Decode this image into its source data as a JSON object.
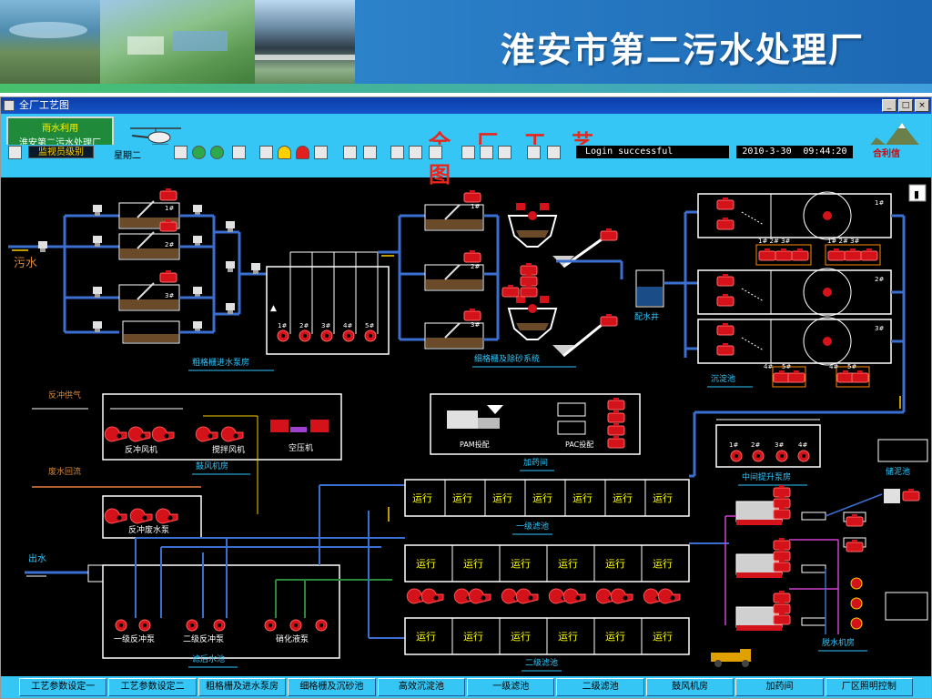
{
  "banner": {
    "title": "淮安市第二污水处理厂"
  },
  "window": {
    "title": "全厂工艺图"
  },
  "header": {
    "logo_line1": "雨水利用",
    "logo_line2": "淮安第二污水处理厂",
    "title": "全 厂 工 艺 图",
    "brand": "合利信"
  },
  "toolbar": {
    "user_level": "监视员级别",
    "weekday": "星期二",
    "status": "Login successful",
    "date": "2010-3-30",
    "time": "09:44:20"
  },
  "diagram": {
    "inflow_label": "污水",
    "outflow_label": "出水",
    "air_label": "反冲供气",
    "return_label": "废水回流",
    "coarse_screen_room": "粗格栅进水泵房",
    "fine_screen_system": "细格栅及除砂系统",
    "distribution_well": "配水井",
    "sedimentation_tank": "沉淀池",
    "blower_room": "鼓风机房",
    "backwash_fan": "反冲风机",
    "mixing_fan": "搅拌风机",
    "air_compressor": "空压机",
    "backwash_waste_pump": "反冲废水泵",
    "dosing_room": "加药间",
    "pam_dosing": "PAM投配",
    "pac_dosing": "PAC投配",
    "mid_lift_pump_room": "中间提升泵房",
    "sludge_tank": "储泥池",
    "primary_filter": "一级滤池",
    "secondary_filter": "二级滤池",
    "filtered_water_tank": "滤后水池",
    "dewatering_room": "脱水机房",
    "primary_backwash_pump": "一级反冲泵",
    "secondary_backwash_pump": "二级反冲泵",
    "nitrification_pump": "硝化液泵",
    "running_label": "运行",
    "pump_numbers": [
      "1#",
      "2#",
      "3#",
      "4#",
      "5#"
    ],
    "tank_numbers": [
      "1#",
      "2#",
      "3#"
    ],
    "mid_pump_numbers": [
      "1#",
      "2#",
      "3#",
      "4#"
    ],
    "sed_pump_numbers": [
      "1#",
      "2#",
      "3#",
      "4#",
      "5#"
    ]
  },
  "nav": [
    "工艺参数设定一",
    "工艺参数设定二",
    "粗格栅及进水泵房",
    "细格栅及沉砂池",
    "高效沉淀池",
    "一级滤池",
    "二级滤池",
    "鼓风机房",
    "加药间",
    "厂区照明控制"
  ],
  "colors": {
    "banner_blue": "#2a7fc7",
    "hmi_cyan": "#35c6f6",
    "diagram_bg": "#000000",
    "pipe_blue": "#3a6fd0",
    "pipe_white": "#ffffff",
    "title_red": "#e8261c",
    "label_cyan": "#2fc8ff",
    "run_yellow": "#ffff00",
    "equipment_red": "#d4121a"
  }
}
